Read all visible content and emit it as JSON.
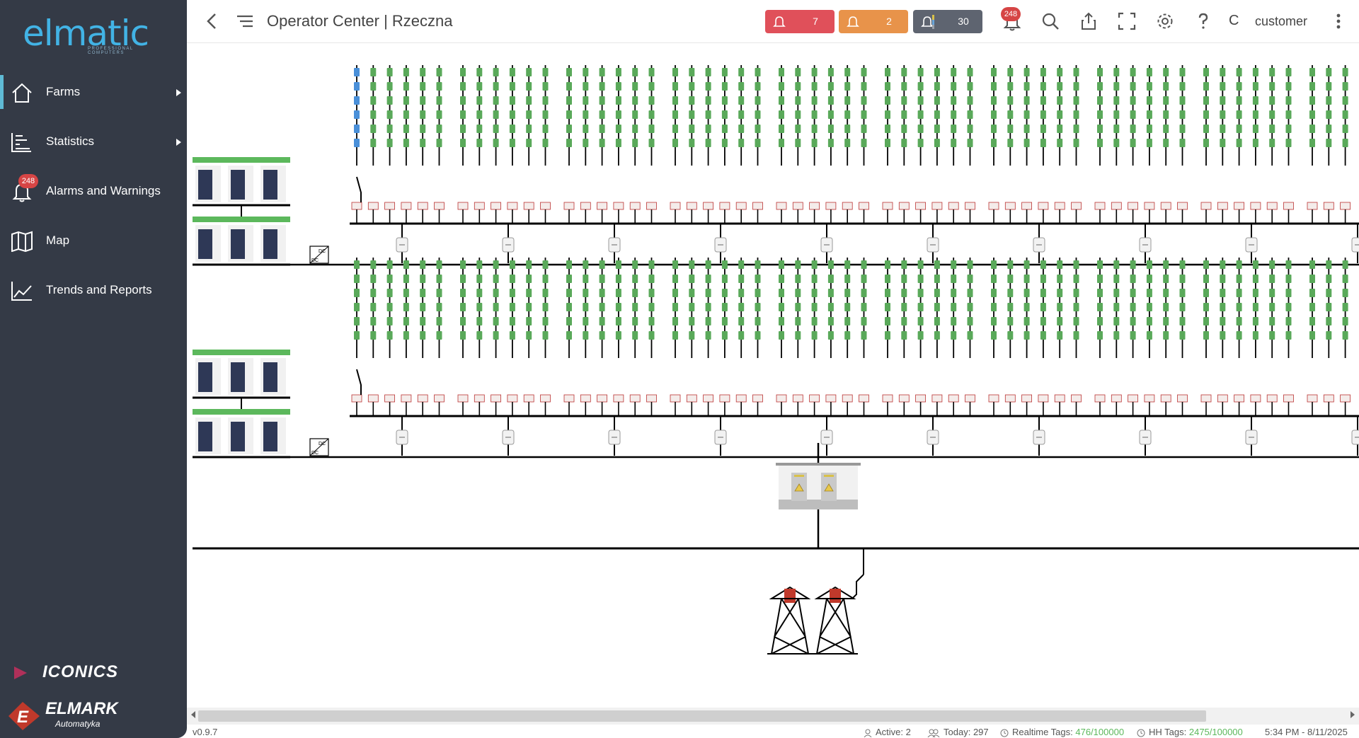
{
  "brand": {
    "logo": "elmatic",
    "logo_sub": "PROFESSIONAL COMPUTERS",
    "iconics": "ICONICS",
    "elmark": "ELMARK",
    "elmark_sub": "Automatyka"
  },
  "sidebar": {
    "items": [
      {
        "label": "Farms",
        "icon": "home-icon",
        "active": true,
        "has_submenu": true
      },
      {
        "label": "Statistics",
        "icon": "statistics-icon",
        "has_submenu": true
      },
      {
        "label": "Alarms and Warnings",
        "icon": "bell-icon",
        "badge": "248"
      },
      {
        "label": "Map",
        "icon": "map-icon"
      },
      {
        "label": "Trends and Reports",
        "icon": "chart-line-icon"
      }
    ]
  },
  "header": {
    "title": "Operator Center | Rzeczna",
    "alarms": {
      "critical": "7",
      "warning": "2",
      "other": "30"
    },
    "notification_badge": "248",
    "user_initial": "C",
    "user_name": "customer"
  },
  "diagram": {
    "dc_label": "DC",
    "colors": {
      "panel_ok": "#5aa95a",
      "panel_selected": "#4a90d9",
      "battery_header": "#5cb85c",
      "battery_cell": "#2e3856",
      "transformer_mark": "#c0392b",
      "line": "#000000"
    }
  },
  "status": {
    "version": "v0.9.7",
    "active_label": "Active:",
    "active": "2",
    "today_label": "Today:",
    "today": "297",
    "realtime_label": "Realtime Tags:",
    "realtime": "476/100000",
    "hh_label": "HH Tags:",
    "hh": "2475/100000",
    "datetime": "5:34 PM - 8/11/2025"
  }
}
